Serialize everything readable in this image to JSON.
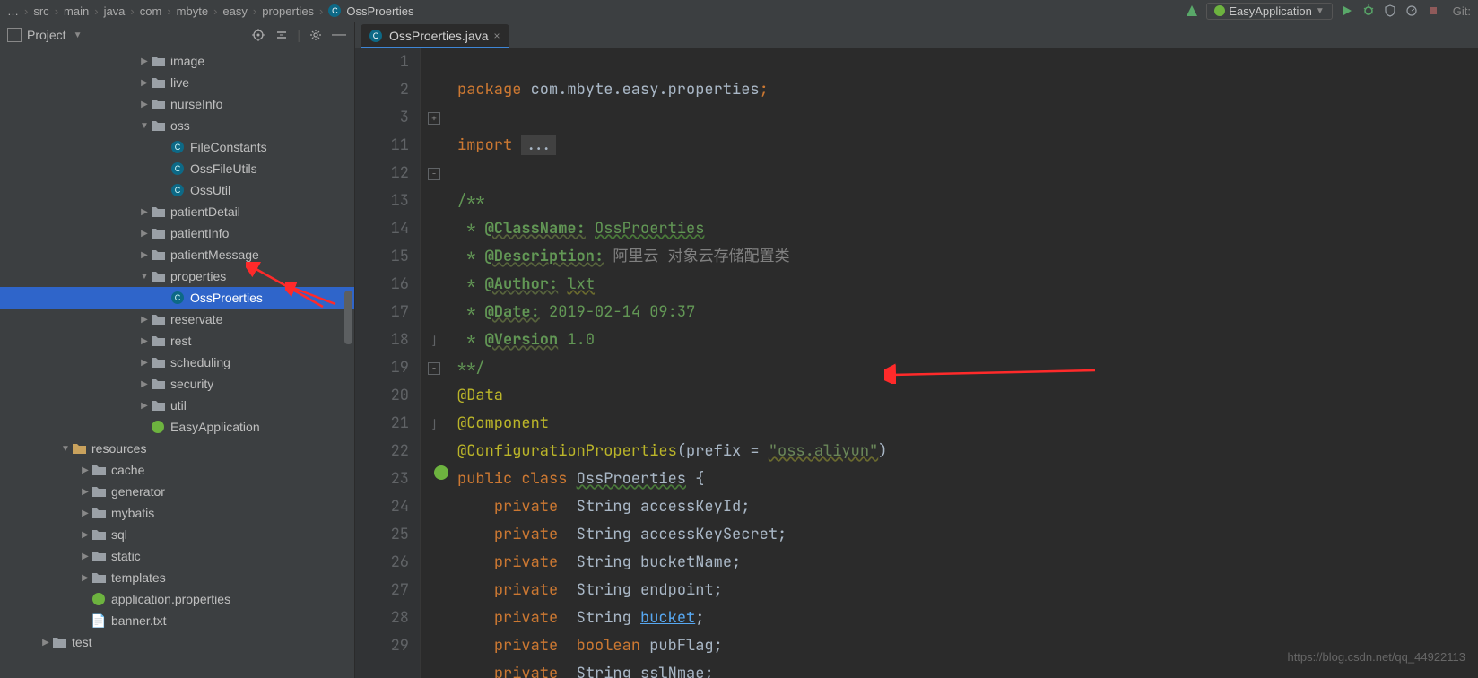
{
  "breadcrumbs": [
    "…",
    "src",
    "main",
    "java",
    "com",
    "mbyte",
    "easy",
    "properties"
  ],
  "breadcrumb_current": "OssProerties",
  "run_config": "EasyApplication",
  "vcs_label": "Git:",
  "project_label": "Project",
  "tree": [
    {
      "depth": 7,
      "arrow": "▶",
      "icon": "folder",
      "label": "image"
    },
    {
      "depth": 7,
      "arrow": "▶",
      "icon": "folder",
      "label": "live"
    },
    {
      "depth": 7,
      "arrow": "▶",
      "icon": "folder",
      "label": "nurseInfo"
    },
    {
      "depth": 7,
      "arrow": "▼",
      "icon": "folder",
      "label": "oss"
    },
    {
      "depth": 8,
      "arrow": "",
      "icon": "jclass",
      "label": "FileConstants"
    },
    {
      "depth": 8,
      "arrow": "",
      "icon": "jclass",
      "label": "OssFileUtils"
    },
    {
      "depth": 8,
      "arrow": "",
      "icon": "jclass",
      "label": "OssUtil"
    },
    {
      "depth": 7,
      "arrow": "▶",
      "icon": "folder",
      "label": "patientDetail"
    },
    {
      "depth": 7,
      "arrow": "▶",
      "icon": "folder",
      "label": "patientInfo"
    },
    {
      "depth": 7,
      "arrow": "▶",
      "icon": "folder",
      "label": "patientMessage"
    },
    {
      "depth": 7,
      "arrow": "▼",
      "icon": "folder",
      "label": "properties"
    },
    {
      "depth": 8,
      "arrow": "",
      "icon": "jclass",
      "label": "OssProerties",
      "selected": true
    },
    {
      "depth": 7,
      "arrow": "▶",
      "icon": "folder",
      "label": "reservate"
    },
    {
      "depth": 7,
      "arrow": "▶",
      "icon": "folder",
      "label": "rest"
    },
    {
      "depth": 7,
      "arrow": "▶",
      "icon": "folder",
      "label": "scheduling"
    },
    {
      "depth": 7,
      "arrow": "▶",
      "icon": "folder",
      "label": "security"
    },
    {
      "depth": 7,
      "arrow": "▶",
      "icon": "folder",
      "label": "util"
    },
    {
      "depth": 7,
      "arrow": "",
      "icon": "spring",
      "label": "EasyApplication"
    },
    {
      "depth": 3,
      "arrow": "▼",
      "icon": "resfolder",
      "label": "resources"
    },
    {
      "depth": 4,
      "arrow": "▶",
      "icon": "folder",
      "label": "cache"
    },
    {
      "depth": 4,
      "arrow": "▶",
      "icon": "folder",
      "label": "generator"
    },
    {
      "depth": 4,
      "arrow": "▶",
      "icon": "folder",
      "label": "mybatis"
    },
    {
      "depth": 4,
      "arrow": "▶",
      "icon": "folder",
      "label": "sql"
    },
    {
      "depth": 4,
      "arrow": "▶",
      "icon": "folder",
      "label": "static"
    },
    {
      "depth": 4,
      "arrow": "▶",
      "icon": "folder",
      "label": "templates"
    },
    {
      "depth": 4,
      "arrow": "",
      "icon": "spring",
      "label": "application.properties"
    },
    {
      "depth": 4,
      "arrow": "",
      "icon": "file",
      "label": "banner.txt"
    },
    {
      "depth": 2,
      "arrow": "▶",
      "icon": "folder",
      "label": "test"
    }
  ],
  "tab": {
    "label": "OssProerties.java"
  },
  "line_numbers": [
    "1",
    "2",
    "3",
    "11",
    "12",
    "13",
    "14",
    "15",
    "16",
    "17",
    "18",
    "19",
    "20",
    "21",
    "22",
    "23",
    "24",
    "25",
    "26",
    "27",
    "28",
    "29"
  ],
  "code": {
    "package_kw": "package",
    "package_name": "com.mbyte.easy.properties",
    "import_kw": "import",
    "dots": "...",
    "doc_open": "/**",
    "tag_classname": "@ClassName:",
    "val_classname": "OssProerties",
    "tag_description": "@Description:",
    "val_description": "阿里云 对象云存储配置类",
    "tag_author": "@Author:",
    "val_author": "lxt",
    "tag_date": "@Date:",
    "val_date": "2019-02-14 09:37",
    "tag_version": "@Version",
    "val_version": "1.0",
    "doc_close": "**/",
    "anno_data": "@Data",
    "anno_component": "@Component",
    "anno_cfgprops": "@ConfigurationProperties",
    "cfg_prefix_key": "prefix",
    "cfg_prefix_val": "\"oss.aliyun\"",
    "public": "public",
    "class": "class",
    "classname": "OssProerties",
    "private": "private",
    "t_string": "String",
    "t_bool": "boolean",
    "f1": "accessKeyId",
    "f2": "accessKeySecret",
    "f3": "bucketName",
    "f4": "endpoint",
    "f5": "bucket",
    "f6": "pubFlag",
    "f7": "sslNmae"
  },
  "watermark": "https://blog.csdn.net/qq_44922113"
}
